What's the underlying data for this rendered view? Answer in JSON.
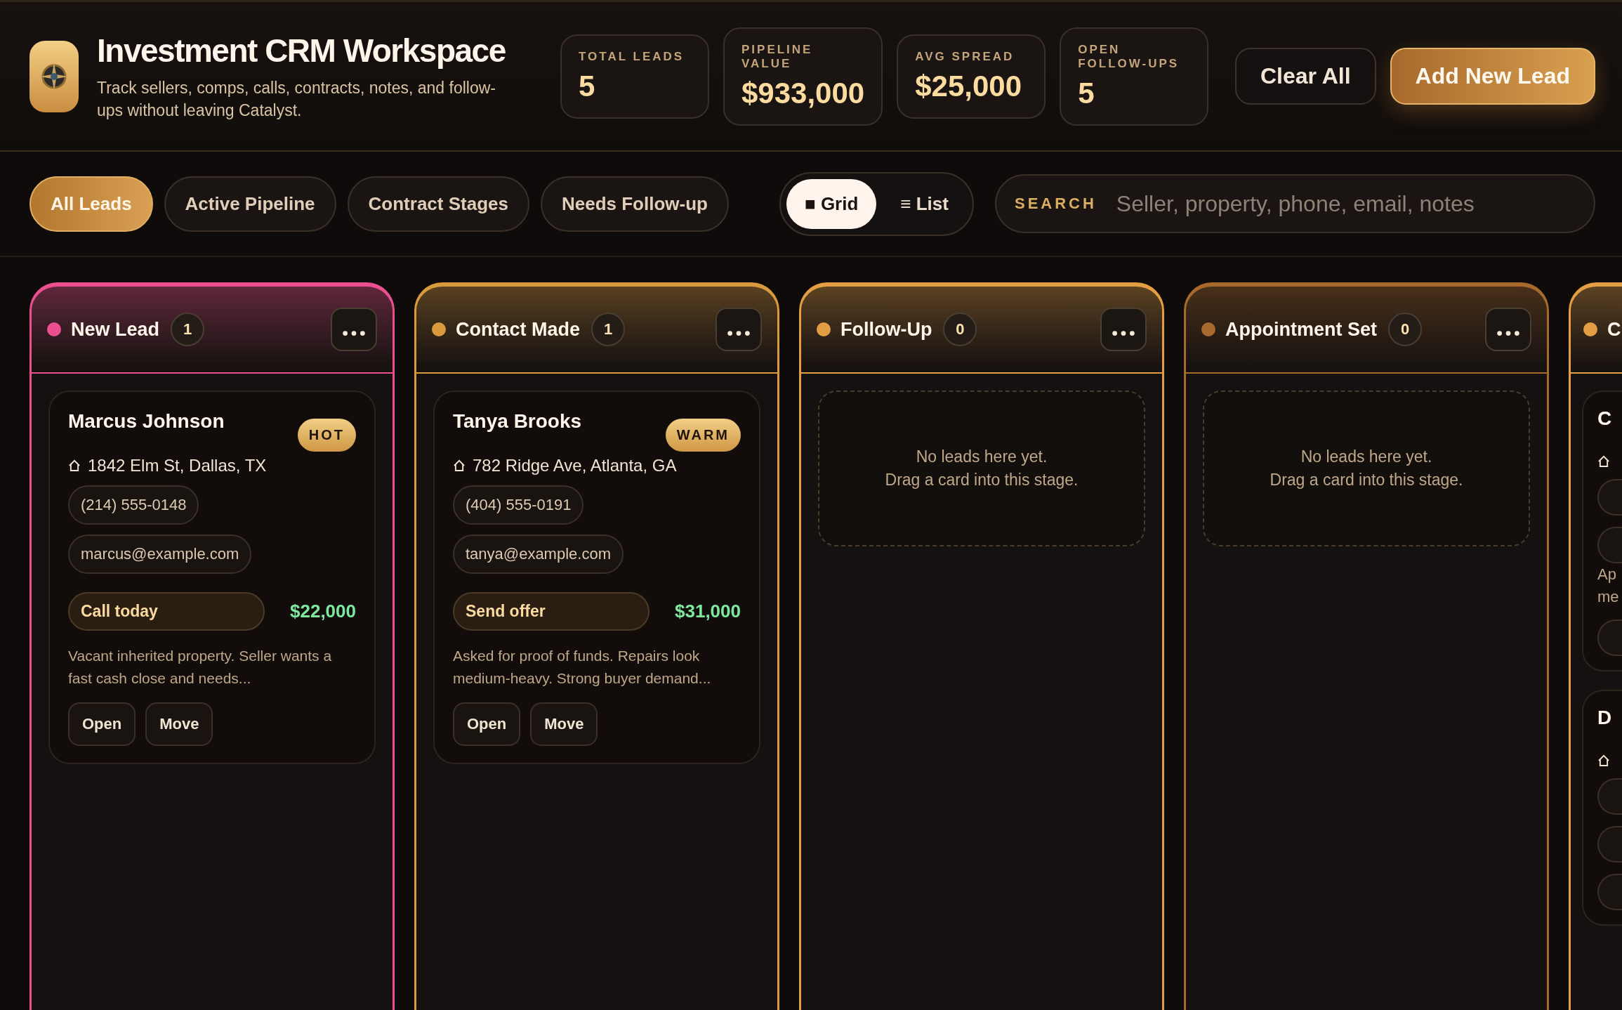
{
  "app": {
    "title": "Investment CRM Workspace",
    "subtitle": "Track sellers, comps, calls, contracts, notes, and follow-ups without leaving Catalyst."
  },
  "stats": [
    {
      "label": "TOTAL LEADS",
      "value": "5"
    },
    {
      "label": "PIPELINE VALUE",
      "value": "$933,000"
    },
    {
      "label": "AVG SPREAD",
      "value": "$25,000"
    },
    {
      "label": "OPEN FOLLOW-UPS",
      "value": "5"
    }
  ],
  "actions": [
    {
      "label": "Clear All",
      "kind": "secondary"
    },
    {
      "label": "Add New Lead",
      "kind": "primary"
    }
  ],
  "filters": [
    {
      "label": "All Leads",
      "selected": true
    },
    {
      "label": "Active Pipeline",
      "selected": false
    },
    {
      "label": "Contract Stages",
      "selected": false
    },
    {
      "label": "Needs Follow-up",
      "selected": false
    }
  ],
  "view_toggle": [
    {
      "icon": "■",
      "label": "Grid",
      "selected": true
    },
    {
      "icon": "≡",
      "label": "List",
      "selected": false
    }
  ],
  "search": {
    "label": "SEARCH",
    "placeholder": "Seller, property, phone, email, notes"
  },
  "columns": [
    {
      "kind": "stage",
      "title": "New Lead",
      "count": "1",
      "color": "#ec4f8f",
      "cards": [
        {
          "name": "Marcus Johnson",
          "priority": "HOT",
          "address": "1842 Elm St, Dallas, TX",
          "phone": "(214) 555-0148",
          "email": "marcus@example.com",
          "next_action": "Call today",
          "spread": "$22,000",
          "notes": "Vacant inherited property. Seller wants a fast cash close and needs...",
          "buttons": [
            "Open",
            "Move"
          ]
        }
      ]
    },
    {
      "kind": "stage",
      "title": "Contact Made",
      "count": "1",
      "color": "#d99a3e",
      "cards": [
        {
          "name": "Tanya Brooks",
          "priority": "WARM",
          "address": "782 Ridge Ave, Atlanta, GA",
          "phone": "(404) 555-0191",
          "email": "tanya@example.com",
          "next_action": "Send offer",
          "spread": "$31,000",
          "notes": "Asked for proof of funds. Repairs look medium-heavy. Strong buyer demand...",
          "buttons": [
            "Open",
            "Move"
          ]
        }
      ]
    },
    {
      "kind": "stage",
      "title": "Follow-Up",
      "count": "0",
      "color": "#e39d42",
      "empty_lines": [
        "No leads here yet.",
        "Drag a card into this stage."
      ]
    },
    {
      "kind": "stage",
      "title": "Appointment Set",
      "count": "0",
      "color": "#a8692c",
      "empty_lines": [
        "No leads here yet.",
        "Drag a card into this stage."
      ]
    },
    {
      "kind": "clipped",
      "title": "C",
      "color": "#e39d42",
      "cards": [
        {
          "name": "C",
          "note_lines": [
            "Ap",
            "me"
          ]
        },
        {
          "name": "D"
        }
      ]
    }
  ]
}
